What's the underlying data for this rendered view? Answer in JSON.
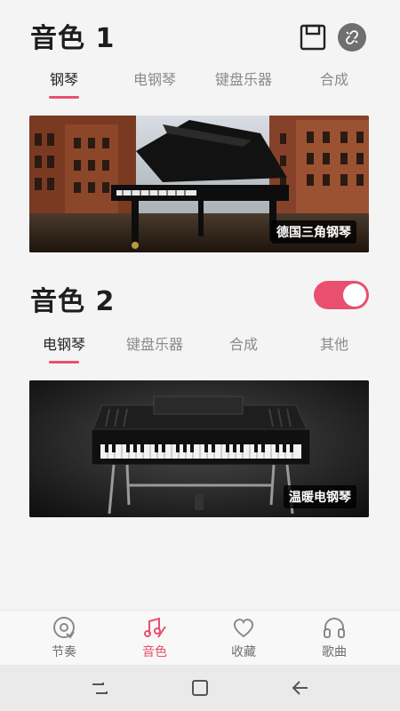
{
  "tone1": {
    "title": "音色 1",
    "tabs": [
      "钢琴",
      "电钢琴",
      "键盘乐器",
      "合成"
    ],
    "active_tab": 0,
    "banner_label": "德国三角钢琴"
  },
  "tone2": {
    "title": "音色 2",
    "toggle_on": true,
    "tabs": [
      "电钢琴",
      "键盘乐器",
      "合成",
      "其他"
    ],
    "active_tab": 0,
    "banner_label": "温暖电钢琴"
  },
  "bottom_nav": {
    "items": [
      {
        "label": "节奏",
        "icon": "metronome-disc-icon"
      },
      {
        "label": "音色",
        "icon": "music-note-pen-icon"
      },
      {
        "label": "收藏",
        "icon": "heart-icon"
      },
      {
        "label": "歌曲",
        "icon": "headphones-icon"
      }
    ],
    "active": 1
  },
  "colors": {
    "accent": "#e94f6e",
    "text": "#1e1e1e",
    "muted": "#8a8a8a"
  }
}
